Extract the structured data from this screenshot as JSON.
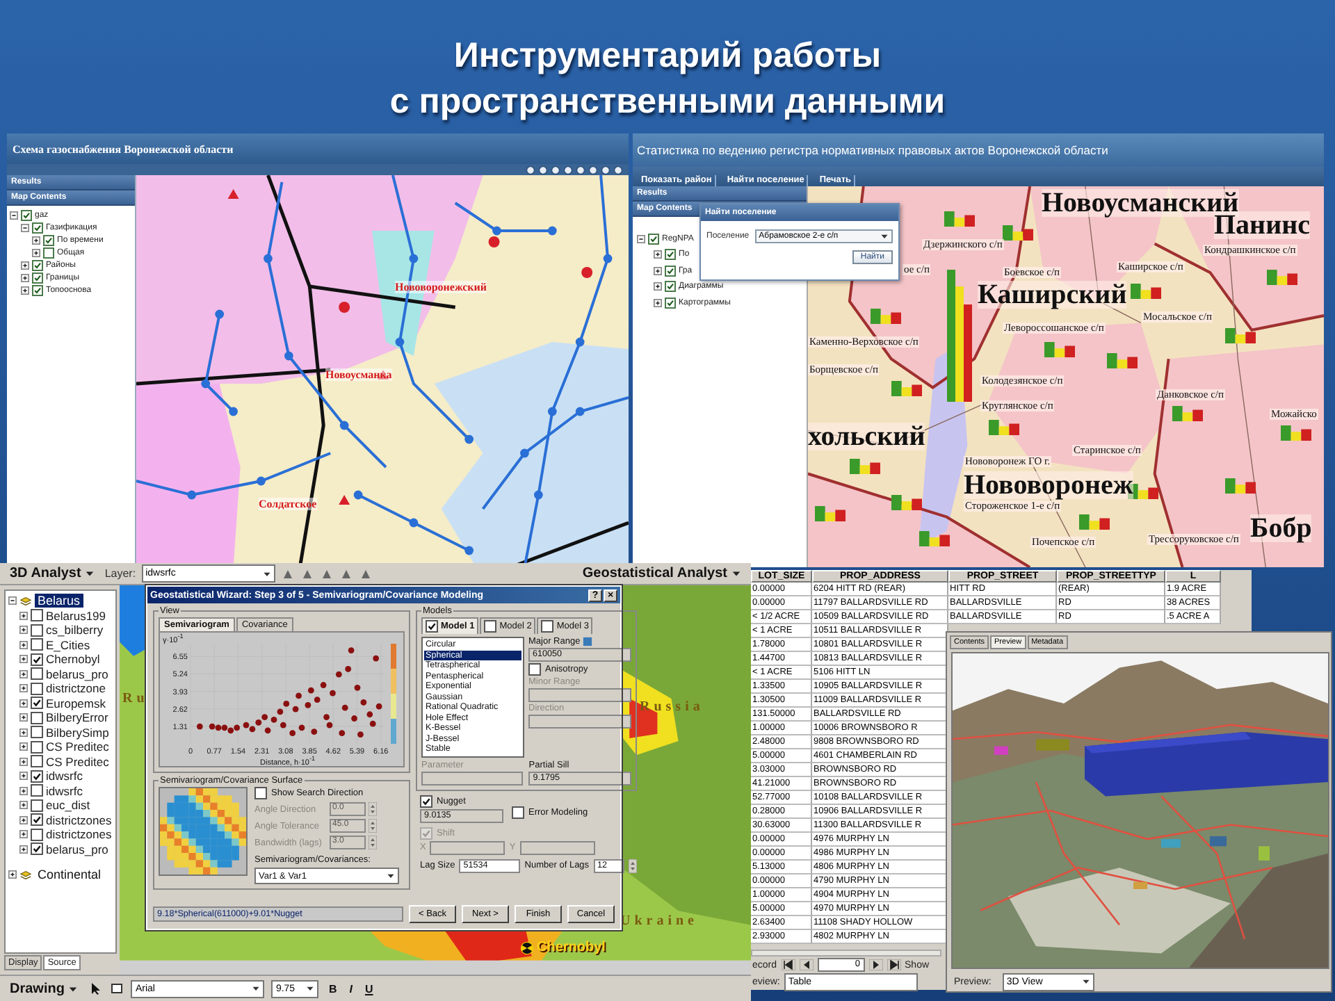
{
  "slide": {
    "title_lines": [
      "Инструментарий работы",
      "с пространственными данными"
    ]
  },
  "gas_app": {
    "title": "Схема газоснабжения Воронежской области",
    "panels": [
      "Results",
      "Map Contents"
    ],
    "layers": [
      {
        "label": "gaz",
        "checked": true,
        "expanded": true,
        "children": [
          {
            "label": "Газификация",
            "checked": true,
            "expanded": true,
            "children": [
              {
                "label": "По времени",
                "checked": true,
                "expanded": false
              },
              {
                "label": "Общая",
                "checked": false,
                "expanded": false
              }
            ]
          },
          {
            "label": "Районы",
            "checked": true,
            "expanded": false
          },
          {
            "label": "Границы",
            "checked": true,
            "expanded": false
          },
          {
            "label": "Топооснова",
            "checked": true,
            "expanded": false
          }
        ]
      }
    ],
    "map_labels": [
      "Нововоронежский",
      "Новоусманка",
      "Солдатское"
    ]
  },
  "reg_app": {
    "title": "Статистика по ведению регистра нормативных правовых актов Воронежской области",
    "toolbar": [
      "Показать район",
      "Найти поселение",
      "Печать"
    ],
    "panels": [
      "Results",
      "Map Contents"
    ],
    "layers": [
      {
        "label": "RegNPA",
        "checked": true,
        "expanded": true,
        "children": [
          {
            "label": "По",
            "checked": true,
            "expanded": false
          },
          {
            "label": "Гра",
            "checked": true,
            "expanded": false
          },
          {
            "label": "Диаграммы",
            "checked": true,
            "expanded": false
          },
          {
            "label": "Картограммы",
            "checked": true,
            "expanded": false
          }
        ]
      }
    ],
    "dialog": {
      "title": "Найти поселение",
      "field_label": "Поселение",
      "value": "Абрамовское 2-е с/п",
      "button": "Найти"
    },
    "map_labels": [
      {
        "text": "Новоусманский",
        "kind": "district"
      },
      {
        "text": "Панинс",
        "kind": "district"
      },
      {
        "text": "Кондрашкинское с/п",
        "kind": "settlement"
      },
      {
        "text": "Дзержинского с/п",
        "kind": "settlement"
      },
      {
        "text": "ое с/п",
        "kind": "settlement"
      },
      {
        "text": "Каширское с/п",
        "kind": "settlement"
      },
      {
        "text": "Боевское с/п",
        "kind": "settlement"
      },
      {
        "text": "Каширский",
        "kind": "district"
      },
      {
        "text": "Мосальское с/п",
        "kind": "settlement"
      },
      {
        "text": "Левороссошанское с/п",
        "kind": "settlement"
      },
      {
        "text": "Каменно-Верховское с/п",
        "kind": "settlement"
      },
      {
        "text": "Борщевское с/п",
        "kind": "settlement"
      },
      {
        "text": "Колодезянское с/п",
        "kind": "settlement"
      },
      {
        "text": "Круглянское с/п",
        "kind": "settlement"
      },
      {
        "text": "Данковское с/п",
        "kind": "settlement"
      },
      {
        "text": "Можайско",
        "kind": "settlement"
      },
      {
        "text": "хольский",
        "kind": "district"
      },
      {
        "text": "Старинское с/п",
        "kind": "settlement"
      },
      {
        "text": "Нововоронеж ГО г.",
        "kind": "settlement"
      },
      {
        "text": "Нововоронеж",
        "kind": "district"
      },
      {
        "text": "Стороженское 1-е с/п",
        "kind": "settlement"
      },
      {
        "text": "Почепское с/п",
        "kind": "settlement"
      },
      {
        "text": "Трессоруковское с/п",
        "kind": "settlement"
      },
      {
        "text": "Бобр",
        "kind": "district"
      }
    ]
  },
  "arcmap": {
    "analyst_menu": "3D Analyst",
    "layer_label": "Layer:",
    "layer_value": "idwsrfc",
    "geo_menu": "Geostatistical Analyst",
    "toc": [
      {
        "label": "Belarus",
        "selected": true,
        "expanded": true,
        "children": [
          {
            "label": "Belarus199",
            "checked": false,
            "expanded": false
          },
          {
            "label": "cs_bilberry",
            "checked": false,
            "expanded": false
          },
          {
            "label": "E_Cities",
            "checked": false,
            "expanded": false
          },
          {
            "label": "Chernobyl",
            "checked": true,
            "expanded": false
          },
          {
            "label": "belarus_pro",
            "checked": false,
            "expanded": false
          },
          {
            "label": "districtzone",
            "checked": false,
            "expanded": false
          },
          {
            "label": "Europemsk",
            "checked": true,
            "expanded": false
          },
          {
            "label": "BilberyError",
            "checked": false,
            "expanded": false
          },
          {
            "label": "BilberySimp",
            "checked": false,
            "expanded": false
          },
          {
            "label": "CS Preditec",
            "checked": false,
            "expanded": false
          },
          {
            "label": "CS Preditec",
            "checked": false,
            "expanded": false
          },
          {
            "label": "idwsrfc",
            "checked": true,
            "expanded": false
          },
          {
            "label": "idwsrfc",
            "checked": false,
            "expanded": false
          },
          {
            "label": "euc_dist",
            "checked": false,
            "expanded": false
          },
          {
            "label": "districtzones",
            "checked": true,
            "expanded": false
          },
          {
            "label": "districtzones",
            "checked": false,
            "expanded": false
          },
          {
            "label": "belarus_pro",
            "checked": true,
            "expanded": false
          }
        ]
      },
      {
        "label": "Continental",
        "selected": false,
        "expanded": false
      }
    ],
    "toc_tabs": [
      {
        "label": "Display",
        "selected": false
      },
      {
        "label": "Source",
        "selected": true
      }
    ],
    "map_labels": [
      {
        "text": "Ru",
        "kind": "country"
      },
      {
        "text": "Russia",
        "kind": "country"
      },
      {
        "text": "Ukraine",
        "kind": "country"
      },
      {
        "text": "Chernobyl",
        "kind": "site"
      }
    ],
    "drawing_menu": "Drawing",
    "font": "Arial",
    "font_size": "9.75",
    "style_buttons": [
      "B",
      "I",
      "U"
    ],
    "wizard": {
      "title": "Geostatistical Wizard: Step 3 of 5 - Semivariogram/Covariance Modeling",
      "title_buttons": [
        "?",
        "×"
      ],
      "view_label": "View",
      "view_tabs": [
        {
          "label": "Semivariogram",
          "selected": true
        },
        {
          "label": "Covariance",
          "selected": false
        }
      ],
      "chart_data": {
        "type": "scatter",
        "xlabel": "Distance, h·10$^{-1}$",
        "ylabel": "γ·10$^{-1}$",
        "xticks": [
          0,
          0.77,
          1.54,
          2.31,
          3.08,
          3.85,
          4.62,
          5.39,
          6.16
        ],
        "yticks": [
          1.31,
          2.62,
          3.93,
          5.24,
          6.55
        ],
        "xlim": [
          0,
          6.3
        ],
        "ylim": [
          0,
          7.5
        ],
        "grid": true,
        "x": [
          0.3,
          0.7,
          0.9,
          1.1,
          1.3,
          1.5,
          1.8,
          2.0,
          2.2,
          2.4,
          2.5,
          2.7,
          2.9,
          3.0,
          3.1,
          3.3,
          3.4,
          3.5,
          3.6,
          3.8,
          3.9,
          4.0,
          4.1,
          4.3,
          4.4,
          4.5,
          4.6,
          4.8,
          4.9,
          5.0,
          5.1,
          5.3,
          5.4,
          5.5,
          5.6,
          5.8,
          5.9,
          6.0,
          6.1,
          5.2
        ],
        "values": [
          1.3,
          1.3,
          1.2,
          1.2,
          1.0,
          1.2,
          1.4,
          1.1,
          1.6,
          2.0,
          1.0,
          1.8,
          2.4,
          1.4,
          3.0,
          0.8,
          2.6,
          3.6,
          1.2,
          2.9,
          4.0,
          0.9,
          3.3,
          4.4,
          2.0,
          1.4,
          3.8,
          5.2,
          0.8,
          2.7,
          5.6,
          1.9,
          4.2,
          0.7,
          3.1,
          2.2,
          1.5,
          6.4,
          2.8,
          7.0
        ]
      },
      "surface_label": "Semivariogram/Covariance Surface",
      "show_search": {
        "label": "Show Search Direction",
        "checked": false
      },
      "search_fields": [
        {
          "label": "Angle Direction",
          "value": "0.0",
          "disabled": true
        },
        {
          "label": "Angle Tolerance",
          "value": "45.0",
          "disabled": true
        },
        {
          "label": "Bandwidth (lags)",
          "value": "3.0",
          "disabled": true
        }
      ],
      "covariances_label": "Semivariogram/Covariances:",
      "covariances_value": "Var1 & Var1",
      "models_label": "Models",
      "model_tabs": [
        {
          "label": "Model 1",
          "checked": true,
          "selected": true
        },
        {
          "label": "Model 2",
          "checked": false,
          "selected": false
        },
        {
          "label": "Model 3",
          "checked": false,
          "selected": false
        }
      ],
      "model_types": [
        {
          "label": "Circular",
          "selected": false
        },
        {
          "label": "Spherical",
          "selected": true
        },
        {
          "label": "Tetraspherical",
          "selected": false
        },
        {
          "label": "Pentaspherical",
          "selected": false
        },
        {
          "label": "Exponential",
          "selected": false
        },
        {
          "label": "Gaussian",
          "selected": false
        },
        {
          "label": "Rational Quadratic",
          "selected": false
        },
        {
          "label": "Hole Effect",
          "selected": false
        },
        {
          "label": "K-Bessel",
          "selected": false
        },
        {
          "label": "J-Bessel",
          "selected": false
        },
        {
          "label": "Stable",
          "selected": false
        }
      ],
      "major_range": {
        "label": "Major Range",
        "value": "610050",
        "disabled": false
      },
      "anisotropy": {
        "label": "Anisotropy",
        "checked": false
      },
      "minor_range": {
        "label": "Minor Range",
        "disabled": true
      },
      "direction": {
        "label": "Direction",
        "disabled": true
      },
      "parameter": {
        "label": "Parameter",
        "disabled": true
      },
      "partial_sill": {
        "label": "Partial Sill",
        "value": "9.1795",
        "disabled": false
      },
      "nugget": {
        "label": "Nugget",
        "checked": true,
        "value": "9.0135"
      },
      "error_modeling": {
        "label": "Error Modeling",
        "checked": false
      },
      "shift": {
        "label": "Shift",
        "checked": true,
        "disabled": true
      },
      "x_label": "X",
      "y_label": "Y",
      "lag_size": {
        "label": "Lag Size",
        "value": "51534"
      },
      "lags": {
        "label": "Number of Lags",
        "value": "12"
      },
      "formula": "9.18*Spherical(611000)+9.01*Nugget",
      "buttons": [
        "< Back",
        "Next >",
        "Finish",
        "Cancel"
      ]
    }
  },
  "table_app": {
    "columns": [
      "LOT_SIZE",
      "PROP_ADDRESS",
      "PROP_STREET",
      "PROP_STREETTYP",
      "L"
    ],
    "rows": [
      [
        "0.00000",
        "6204 HITT RD (REAR)",
        "HITT RD",
        "(REAR)",
        "1.9 ACRE"
      ],
      [
        "0.00000",
        "11797 BALLARDSVILLE RD",
        "BALLARDSVILLE",
        "RD",
        "38 ACRES"
      ],
      [
        "< 1/2 ACRE",
        "10509 BALLARDSVILLE RD",
        "BALLARDSVILLE",
        "RD",
        ".5 ACRE A"
      ],
      [
        "< 1 ACRE",
        "10511 BALLARDSVILLE R"
      ],
      [
        "1.78000",
        "10801 BALLARDSVILLE R"
      ],
      [
        "1.44700",
        "10813 BALLARDSVILLE R"
      ],
      [
        "< 1 ACRE",
        "5106 HITT LN"
      ],
      [
        "1.33500",
        "10905 BALLARDSVILLE R"
      ],
      [
        "1.30500",
        "11009 BALLARDSVILLE R"
      ],
      [
        "131.50000",
        "BALLARDSVILLE RD"
      ],
      [
        "1.00000",
        "10006 BROWNSBORO R"
      ],
      [
        "2.48000",
        "9808 BROWNSBORO RD"
      ],
      [
        "5.00000",
        "4601 CHAMBERLAIN RD"
      ],
      [
        "3.03000",
        "BROWNSBORO RD"
      ],
      [
        "41.21000",
        "BROWNSBORO RD"
      ],
      [
        "52.77000",
        "10108 BALLARDSVILLE R"
      ],
      [
        "0.28000",
        "10906 BALLARDSVILLE R"
      ],
      [
        "30.63000",
        "11300 BALLARDSVILLE R"
      ],
      [
        "0.00000",
        "4976 MURPHY LN"
      ],
      [
        "0.00000",
        "4986 MURPHY LN"
      ],
      [
        "5.13000",
        "4806 MURPHY LN"
      ],
      [
        "0.00000",
        "4790 MURPHY LN"
      ],
      [
        "1.00000",
        "4904 MURPHY LN"
      ],
      [
        "5.00000",
        "4970 MURPHY LN"
      ],
      [
        "2.63400",
        "11108 SHADY HOLLOW"
      ],
      [
        "2.93000",
        "4802 MURPHY LN"
      ]
    ],
    "record_label": "ecord",
    "record_value": "0",
    "show_label": "Show",
    "preview_label": "eview:",
    "preview_value": "Table",
    "preview_window": {
      "tabs": [
        {
          "label": "Contents",
          "selected": false
        },
        {
          "label": "Preview",
          "selected": true
        },
        {
          "label": "Metadata",
          "selected": false
        }
      ],
      "preview_label": "Preview:",
      "preview_value": "3D View"
    }
  }
}
